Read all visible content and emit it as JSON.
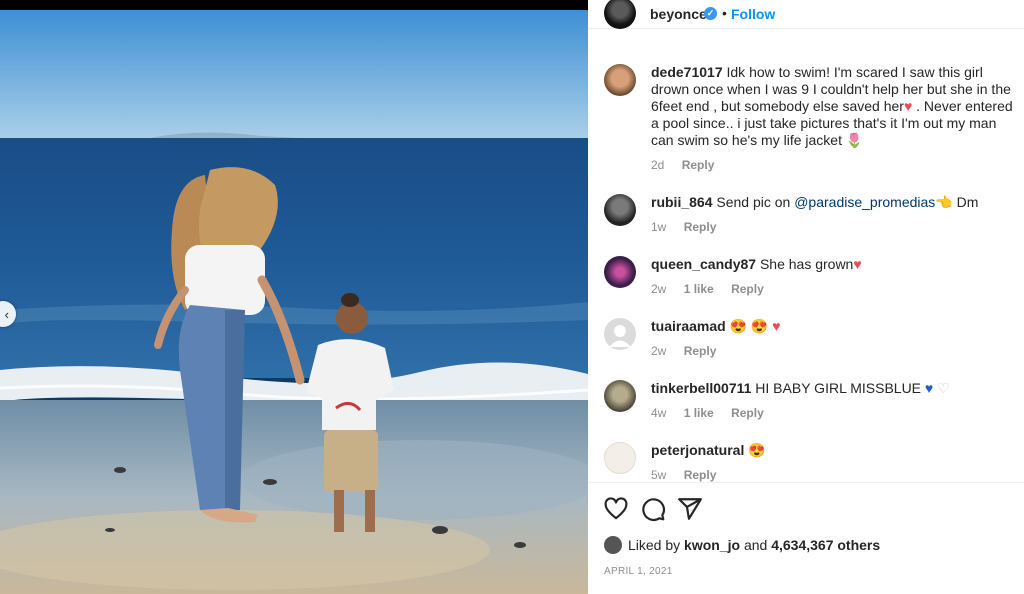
{
  "post": {
    "username": "beyonce",
    "verified_icon": "✓",
    "separator": "•",
    "follow_label": "Follow"
  },
  "comments": [
    {
      "author": "dede71017",
      "text_parts": [
        "Idk how to swim! I'm scared I saw this girl drown once when I was 9 I couldn't help her but she in the 6feet end , but somebody else saved her",
        " . Never entered a pool since.. i just take pictures that's it I'm out my man can swim so he's my life jacket "
      ],
      "emoji_heart": "♥",
      "emoji_tulip": "🌷",
      "time": "2d",
      "reply": "Reply"
    },
    {
      "author": "rubii_864",
      "text": "Send pic on ",
      "mention": "@paradise_promedias",
      "emoji_point": "👈",
      "text_end": " Dm",
      "time": "1w",
      "reply": "Reply"
    },
    {
      "author": "queen_candy87",
      "text": "She has grown",
      "emoji": "♥",
      "time": "2w",
      "likes": "1 like",
      "reply": "Reply"
    },
    {
      "author": "tuairaamad",
      "emoji": "😍 😍 ♥",
      "time": "2w",
      "reply": "Reply"
    },
    {
      "author": "tinkerbell00711",
      "text": "HI BABY GIRL MISSBLUE",
      "emoji_blue": "♥",
      "emoji_white": "♡",
      "time": "4w",
      "likes": "1 like",
      "reply": "Reply"
    },
    {
      "author": "peterjonatural",
      "emoji": "😍",
      "time": "5w",
      "reply": "Reply"
    }
  ],
  "likes": {
    "prefix": "Liked by",
    "user": "kwon_jo",
    "and": "and",
    "count": "4,634,367 others"
  },
  "date": "APRIL 1, 2021",
  "icons": [
    "heart-icon",
    "comment-icon",
    "share-icon",
    "chevron-left-icon"
  ],
  "colors": {
    "link": "#0095f6",
    "muted": "#8e8e8e",
    "heart": "#ed4956"
  }
}
